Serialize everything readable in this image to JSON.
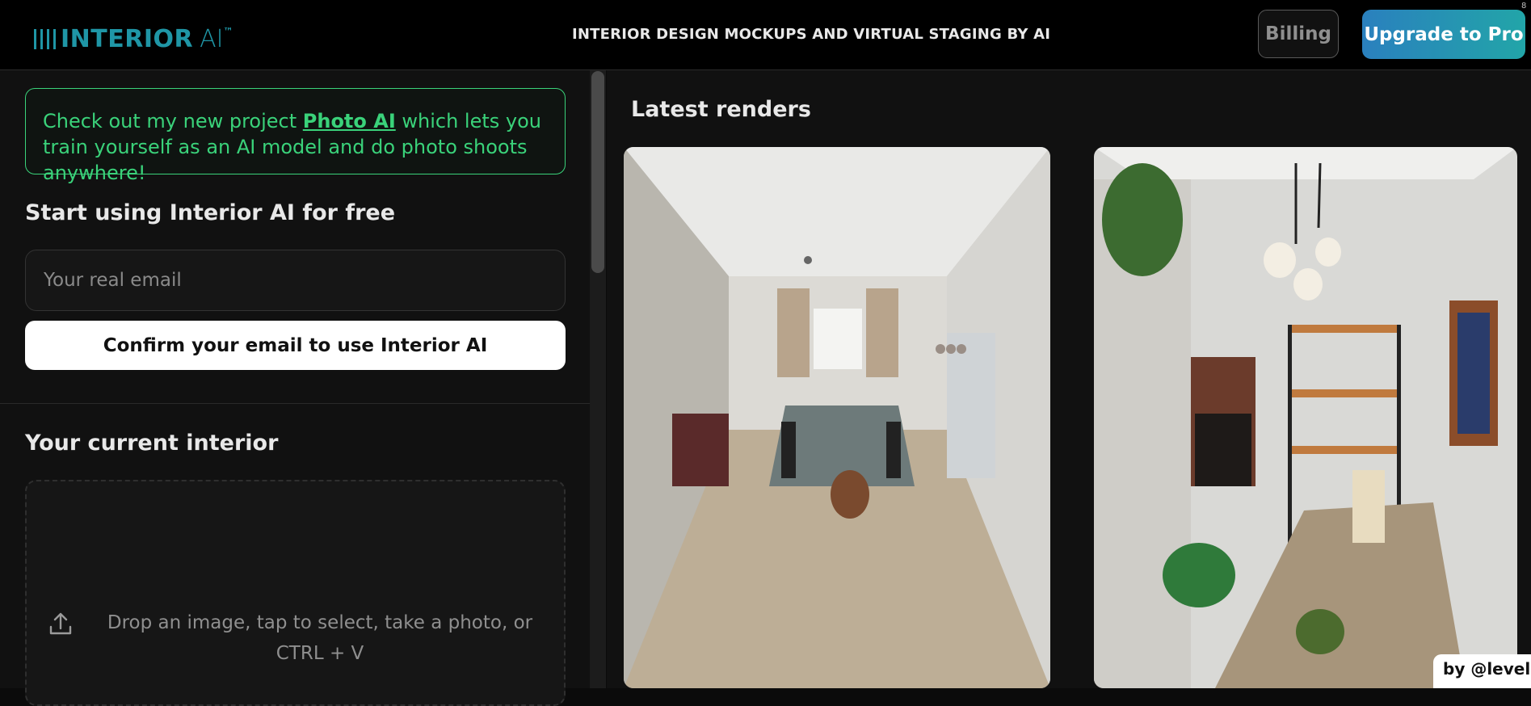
{
  "header": {
    "logo_text": "INTERIOR",
    "logo_ai": "AI",
    "logo_tm": "™",
    "tagline": "INTERIOR DESIGN MOCKUPS AND VIRTUAL STAGING BY AI",
    "billing_label": "Billing",
    "upgrade_label": "Upgrade to Pro",
    "close_glyph": "8"
  },
  "promo": {
    "prefix": "Check out my new project ",
    "link_text": "Photo AI",
    "suffix": " which lets you train yourself as an AI model and do photo shoots anywhere!"
  },
  "signup": {
    "heading": "Start using Interior AI for free",
    "email_placeholder": "Your real email",
    "confirm_label": "Confirm your email to use Interior AI"
  },
  "upload": {
    "heading": "Your current interior",
    "dropzone_text": "Drop an image, tap to select, take a photo, or CTRL + V"
  },
  "gallery": {
    "heading": "Latest renders",
    "renders": [
      {
        "id": "render-1",
        "subject": "dining room with glass table and pendant light"
      },
      {
        "id": "render-2",
        "subject": "rustic dining room with wooden table, plants and shelves"
      }
    ]
  },
  "credit": {
    "label": "by @levelsio"
  },
  "colors": {
    "brand_teal": "#1f96a6",
    "promo_green": "#3ad27a",
    "upgrade_gradient_start": "#2a80be",
    "upgrade_gradient_end": "#22a5a8"
  }
}
